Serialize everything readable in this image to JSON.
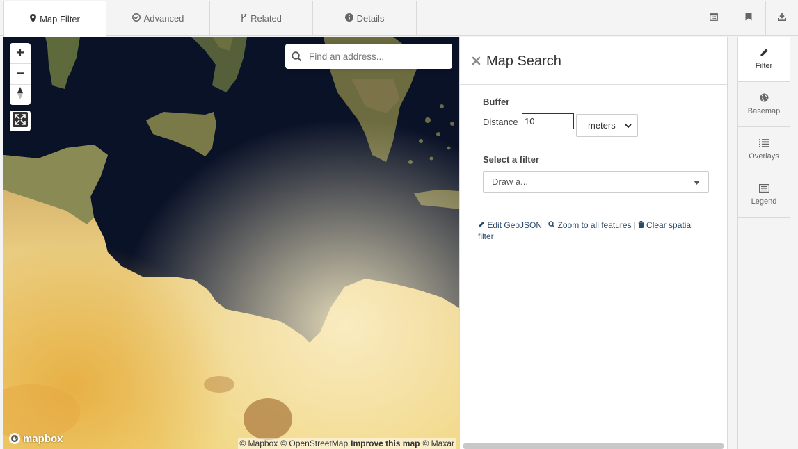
{
  "tabs": [
    {
      "label": "Map Filter",
      "icon": "map-marker-icon",
      "active": true
    },
    {
      "label": "Advanced",
      "icon": "check-circle-icon",
      "active": false
    },
    {
      "label": "Related",
      "icon": "branch-icon",
      "active": false
    },
    {
      "label": "Details",
      "icon": "info-circle-icon",
      "active": false
    }
  ],
  "toolbar": {
    "icons": [
      "calendar-icon",
      "bookmark-icon",
      "download-icon"
    ]
  },
  "map": {
    "zoom_in": "+",
    "zoom_out": "−",
    "search_placeholder": "Find an address...",
    "logo_text": "mapbox",
    "attribution": {
      "mapbox": "© Mapbox",
      "osm": "© OpenStreetMap",
      "improve": "Improve this map",
      "maxar": "© Maxar"
    }
  },
  "panel": {
    "title": "Map Search",
    "buffer_label": "Buffer",
    "distance_label": "Distance",
    "distance_value": "10",
    "unit_value": "meters",
    "filter_label": "Select a filter",
    "filter_value": "Draw a...",
    "links": {
      "edit": "Edit GeoJSON",
      "zoom": "Zoom to all features",
      "clear": "Clear spatial filter",
      "separator": "|"
    }
  },
  "rail": {
    "items": [
      {
        "label": "Filter",
        "icon": "pencil-icon",
        "active": true
      },
      {
        "label": "Basemap",
        "icon": "globe-icon",
        "active": false
      },
      {
        "label": "Overlays",
        "icon": "list-icon",
        "active": false
      },
      {
        "label": "Legend",
        "icon": "legend-icon",
        "active": false
      }
    ]
  },
  "colors": {
    "sea": "#0a1228",
    "desert": "#e8c468",
    "link": "#2a4a6a",
    "chrome": "#f4f4f4"
  }
}
